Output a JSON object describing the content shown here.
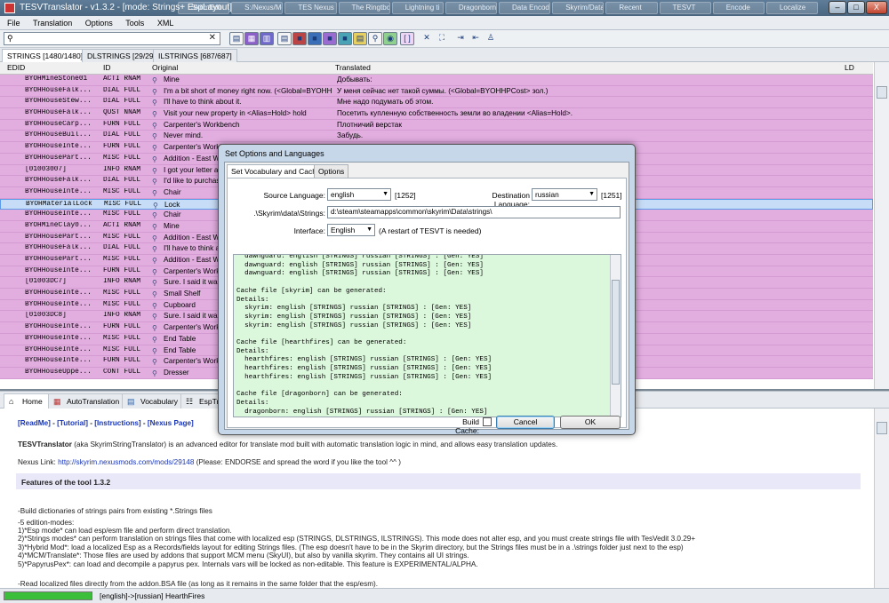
{
  "titlebar": {
    "title": "TESVTranslator - v1.3.2 - [mode: Strings+ EspLayout]",
    "min": "–",
    "max": "□",
    "close": "X",
    "taskbar_items": [
      "SkrimEdit",
      "S:/Nexus/Mods",
      "TES Nexus",
      "The Ringtbo",
      "Lightning ti",
      "Dragonborn",
      "Data Encode",
      "Skyrim/Data",
      "Recent",
      "TESVT",
      "Encode",
      "Localize"
    ]
  },
  "menu": [
    "File",
    "Translation",
    "Options",
    "Tools",
    "XML"
  ],
  "search": {
    "icon": "search-icon",
    "value": "",
    "clear": "✕"
  },
  "tabs": [
    {
      "label": "STRINGS [1480/1480]"
    },
    {
      "label": "DLSTRINGS [29/29]"
    },
    {
      "label": "ILSTRINGS [687/687]"
    }
  ],
  "grid": {
    "columns": [
      "EDID",
      "ID",
      "Original",
      "Translated",
      "LD"
    ],
    "rows": [
      [
        "BYOHMineStone01",
        "ACTI RNAM",
        "Mine",
        "Добывать:"
      ],
      [
        "BYOHHouseFalk...",
        "DIAL FULL",
        "I'm a bit short of money right now. (<Global=BYOHH...",
        "У меня сейчас нет такой суммы. (<Global=BYOHHPCost> зол.)"
      ],
      [
        "BYOHHouseStew...",
        "DIAL FULL",
        "I'll have to think about it.",
        "Мне надо подумать об этом."
      ],
      [
        "BYOHHouseFalk...",
        "QUST NNAM",
        "Visit your new property in <Alias=Hold> hold",
        "Посетить купленную собственность земли во владении <Alias=Hold>."
      ],
      [
        "BYOHHouseCarp...",
        "FURN FULL",
        "Carpenter's Workbench",
        "Плотничий верстак"
      ],
      [
        "BYOHHouseBuil...",
        "DIAL FULL",
        "Never mind.",
        "Забудь."
      ],
      [
        "BYOHHouseInte...",
        "FURN FULL",
        "Carpenter's Workb",
        ""
      ],
      [
        "BYOHHousePart...",
        "MISC FULL",
        "Addition - East W",
        ""
      ],
      [
        "[01003007]",
        "INFO RNAM",
        "I got your letter a",
        ""
      ],
      [
        "BYOHHouseFalk...",
        "DIAL FULL",
        "I'd like to purchas",
        ""
      ],
      [
        "BYOHHouseInte...",
        "MISC FULL",
        "Chair",
        ""
      ],
      [
        "BYOHMaterialLock",
        "MISC FULL",
        "Lock",
        ""
      ],
      [
        "BYOHHouseInte...",
        "MISC FULL",
        "Chair",
        ""
      ],
      [
        "BYOHMineClay0...",
        "ACTI RNAM",
        "Mine",
        ""
      ],
      [
        "BYOHHousePart...",
        "MISC FULL",
        "Addition - East W",
        ""
      ],
      [
        "BYOHHouseFalk...",
        "DIAL FULL",
        "I'll have to think a",
        ""
      ],
      [
        "BYOHHousePart...",
        "MISC FULL",
        "Addition - East W",
        ""
      ],
      [
        "BYOHHouseInte...",
        "FURN FULL",
        "Carpenter's Workb",
        ""
      ],
      [
        "[01003DC7]",
        "INFO RNAM",
        "Sure. I said it was",
        ""
      ],
      [
        "BYOHHouseInte...",
        "MISC FULL",
        "Small Shelf",
        ""
      ],
      [
        "BYOHHouseInte...",
        "MISC FULL",
        "Cupboard",
        ""
      ],
      [
        "[01003DC8]",
        "INFO RNAM",
        "Sure. I said it was",
        ""
      ],
      [
        "BYOHHouseInte...",
        "FURN FULL",
        "Carpenter's Workb",
        ""
      ],
      [
        "BYOHHouseInte...",
        "MISC FULL",
        "End Table",
        ""
      ],
      [
        "BYOHHouseInte...",
        "MISC FULL",
        "End Table",
        ""
      ],
      [
        "BYOHHouseInte...",
        "FURN FULL",
        "Carpenter's Workb",
        ""
      ],
      [
        "BYOHHouseUppe...",
        "CONT FULL",
        "Dresser",
        ""
      ]
    ]
  },
  "bottom_tabs": [
    "Home",
    "AutoTranslation",
    "Vocabulary",
    "EspTre"
  ],
  "help": {
    "links": [
      "[ReadMe]",
      "[Tutorial]",
      "[Instructions]",
      "[Nexus Page]"
    ],
    "intro_name": "TESVTranslator",
    "intro_rest": " (aka SkyrimStringTranslator) is an advanced editor for translate mod built with automatic translation logic in mind, and allows easy translation updates.",
    "nexus_label": "Nexus Link: ",
    "nexus_url": "http://skyrim.nexusmods.com/mods/29148",
    "nexus_rest": " (Please: ENDORSE and spread the word if you like the tool ^^ )",
    "features_title": "Features of the tool 1.3.2",
    "lines": [
      "-Build dictionaries of strings pairs from existing *.Strings files",
      "-5 edition-modes:",
      "1)*Esp mode*  can load esp/esm file and perform direct translation.",
      "2)*Strings modes*  can perform translation on strings files that come with localized esp (STRINGS, DLSTRINGS, ILSTRINGS). This mode does not alter esp, and you must create strings file with TesVedit 3.0.29+",
      "3)*Hybrid Mod*: load a localized Esp as a Records/fields layout for editing Strings files. (The esp doesn't have to be in the Skyrim directory, but the Strings files must be in a .\\strings folder just next to the esp)",
      "4)*MCM/Translate*: Those files are used by addons that support MCM menu (SkyUI), but also by vanilla skyrim. They contains all UI strings.",
      "5)*PapyrusPex*: can load and decompile a papyrus pex. Internals vars will be locked as non-editable. This feature is EXPERIMENTAL/ALPHA.",
      "-Read localized files directly from the addon.BSA file (as long as it remains in the same folder that the esp/esm)."
    ]
  },
  "status": {
    "progress": 1.0,
    "text": "[english]->[russian] HearthFires"
  },
  "dialog": {
    "title": "Set Options and Languages",
    "tabs": [
      "Set Vocabulary and Cache",
      "Options"
    ],
    "source_label": "Source Language:",
    "source_value": "english",
    "source_cp": "[1252]",
    "dest_label": "Destination Language:",
    "dest_value": "russian",
    "dest_cp": "[1251]",
    "path_label": ".\\Skyrim\\data\\Strings:",
    "path_value": "d:\\steam\\steamapps\\common\\skyrim\\Data\\strings\\",
    "interface_label": "Interface:",
    "interface_value": "English",
    "interface_note": "(A restart of TESVT is needed)",
    "log_lines": [
      "  dawnguard: english [STRINGS] russian [STRINGS] : [Gen: YES]",
      "  dawnguard: english [STRINGS] russian [STRINGS] : [Gen: YES]",
      "  dawnguard: english [STRINGS] russian [STRINGS] : [Gen: YES]",
      "",
      "Cache file [skyrim] can be generated:",
      "Details:",
      "  skyrim: english [STRINGS] russian [STRINGS] : [Gen: YES]",
      "  skyrim: english [STRINGS] russian [STRINGS] : [Gen: YES]",
      "  skyrim: english [STRINGS] russian [STRINGS] : [Gen: YES]",
      "",
      "Cache file [hearthfires] can be generated:",
      "Details:",
      "  hearthfires: english [STRINGS] russian [STRINGS] : [Gen: YES]",
      "  hearthfires: english [STRINGS] russian [STRINGS] : [Gen: YES]",
      "  hearthfires: english [STRINGS] russian [STRINGS] : [Gen: YES]",
      "",
      "Cache file [dragonborn] can be generated:",
      "Details:",
      "  dragonborn: english [STRINGS] russian [STRINGS] : [Gen: YES]"
    ],
    "build_cache_label": "Build Cache:",
    "cancel": "Cancel",
    "ok": "OK"
  }
}
